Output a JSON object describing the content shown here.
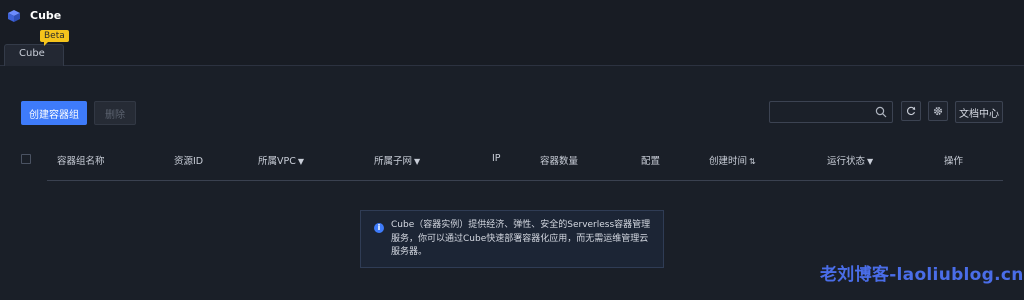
{
  "app": {
    "title": "Cube"
  },
  "tabs": [
    {
      "label": "Cube",
      "badge": "Beta"
    }
  ],
  "toolbar": {
    "create_label": "创建容器组",
    "delete_label": "删除",
    "search_placeholder": "",
    "refresh_icon": "refresh-icon",
    "settings_icon": "gear-icon",
    "docs_label": "文档中心"
  },
  "table": {
    "columns": [
      "容器组名称",
      "资源ID",
      "所属VPC",
      "所属子网",
      "IP",
      "容器数量",
      "配置",
      "创建时间",
      "运行状态",
      "操作"
    ],
    "filter_caret": "▼",
    "sort_icon": "⇅",
    "rows": []
  },
  "notice": {
    "text": "Cube（容器实例）提供经济、弹性、安全的Serverless容器管理服务，你可以通过Cube快速部署容器化应用，而无需运维管理云服务器。"
  },
  "watermark": "老刘博客-laoliublog.cn",
  "colors": {
    "background": "#181c24",
    "primary": "#3e7bfa",
    "badge": "#f5c41c",
    "watermark": "#4a6de8"
  }
}
